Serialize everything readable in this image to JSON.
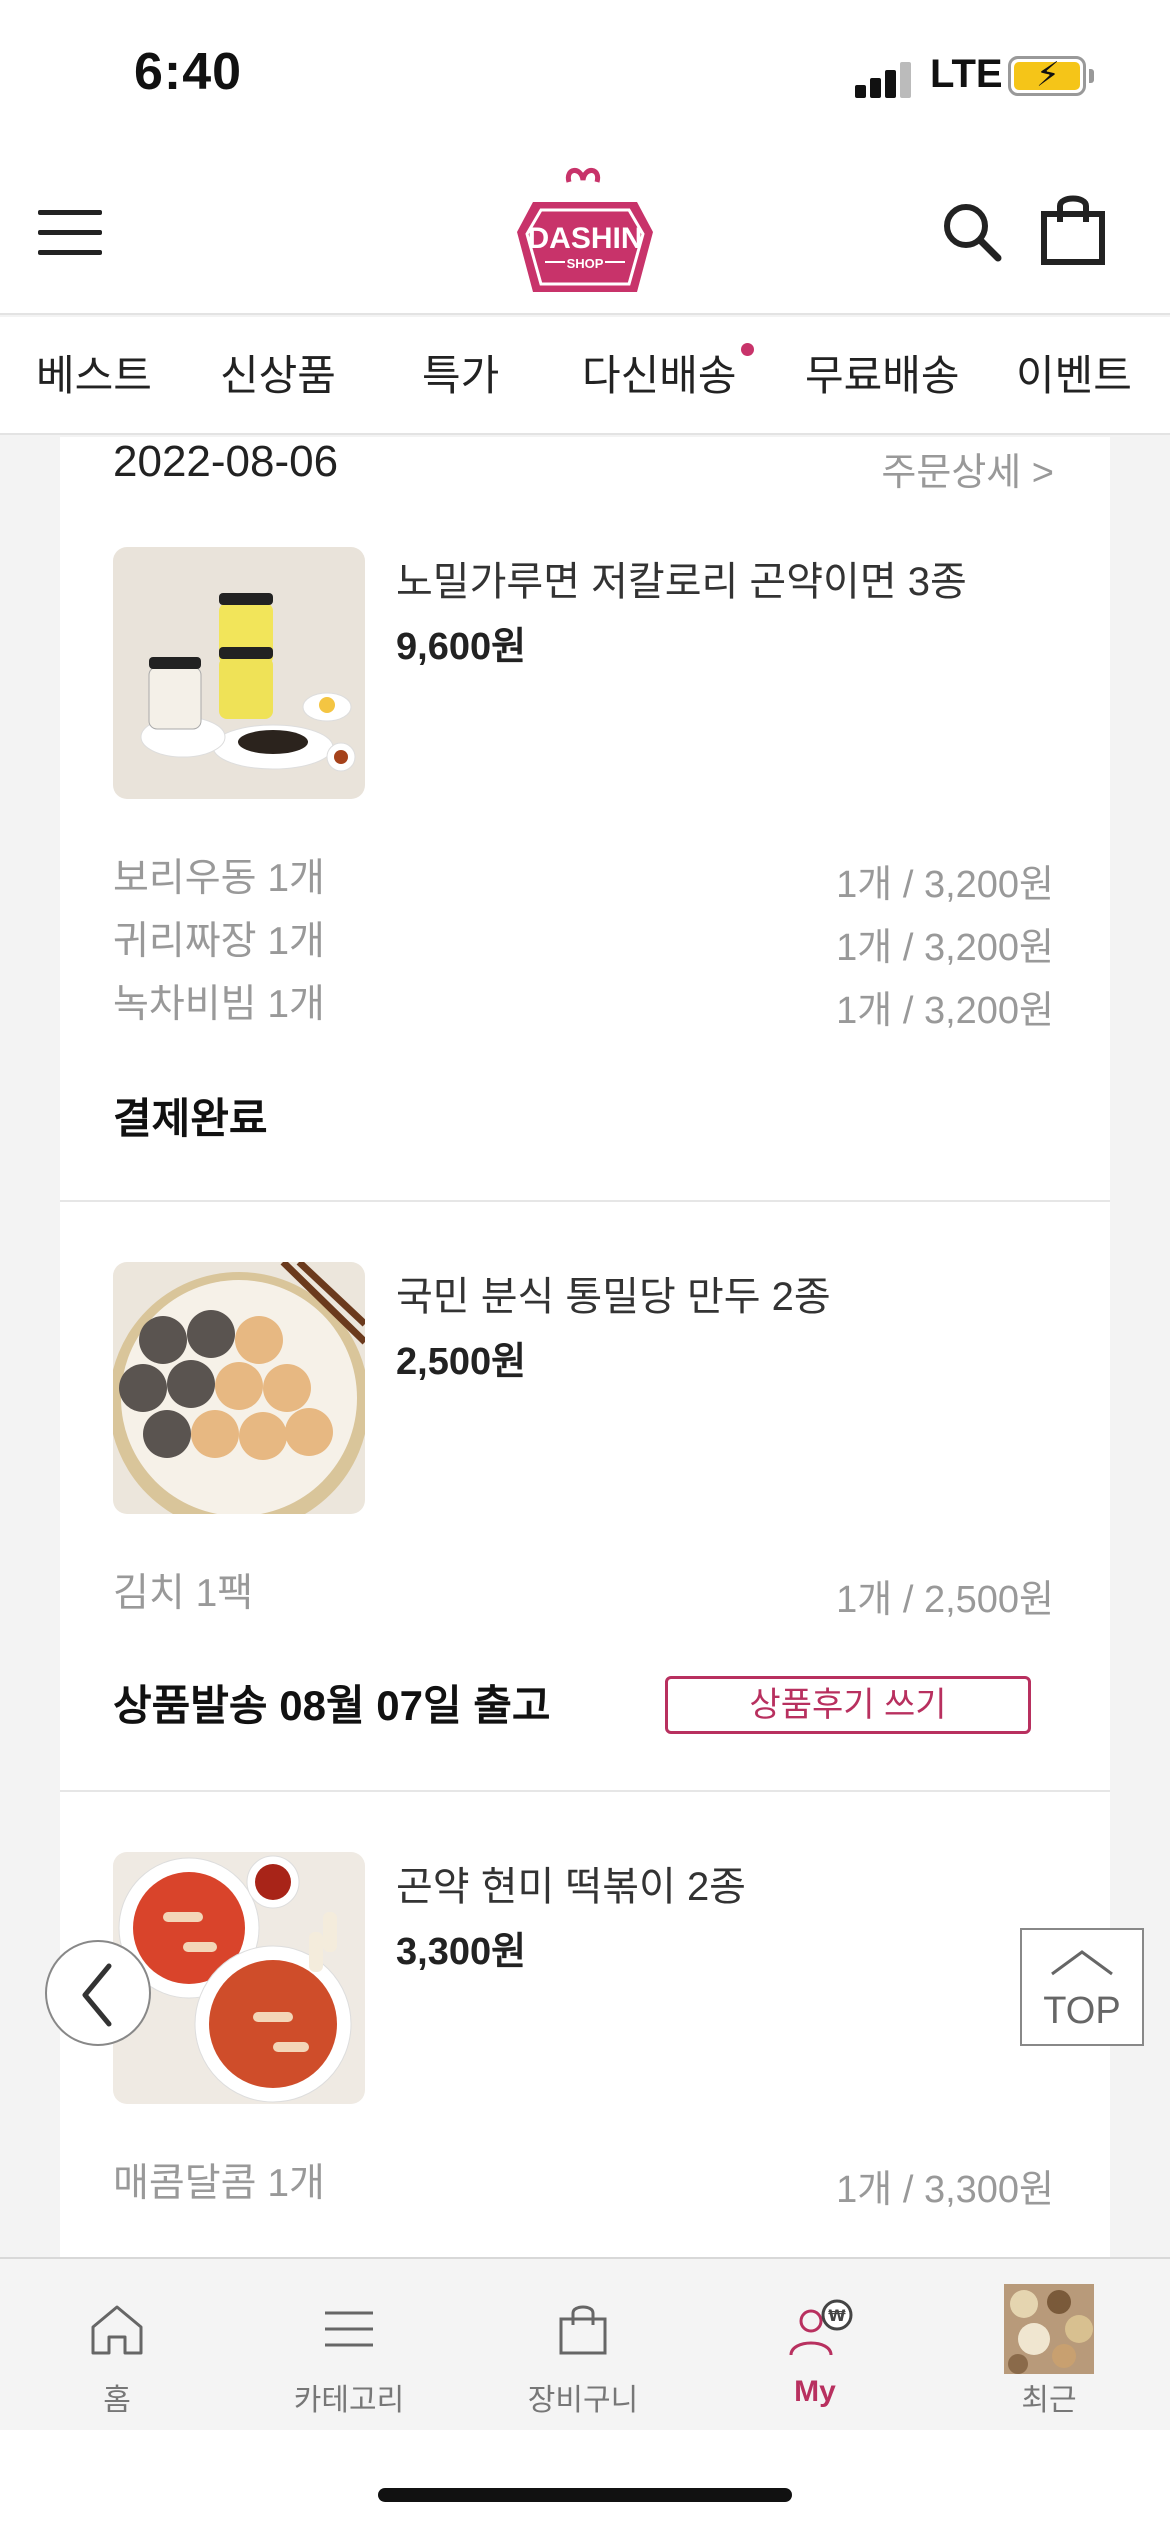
{
  "status_bar": {
    "time": "6:40",
    "network": "LTE"
  },
  "header": {
    "logo_text": "DASHIN",
    "logo_sub": "SHOP"
  },
  "nav": {
    "items": [
      {
        "label": "베스트",
        "dot": false
      },
      {
        "label": "신상품",
        "dot": false
      },
      {
        "label": "특가",
        "dot": false
      },
      {
        "label": "다신배송",
        "dot": true
      },
      {
        "label": "무료배송",
        "dot": false
      },
      {
        "label": "이벤트",
        "dot": false
      }
    ]
  },
  "order": {
    "date": "2022-08-06",
    "detail_link": "주문상세 >",
    "items": [
      {
        "name": "노밀가루면 저칼로리 곤약이면 3종",
        "price": "9,600원",
        "options": [
          {
            "name": "보리우동 1개",
            "qty": "1개 / 3,200원"
          },
          {
            "name": "귀리짜장 1개",
            "qty": "1개 / 3,200원"
          },
          {
            "name": "녹차비빔 1개",
            "qty": "1개 / 3,200원"
          }
        ],
        "status": "결제완료"
      },
      {
        "name": "국민 분식 통밀당 만두 2종",
        "price": "2,500원",
        "options": [
          {
            "name": "김치 1팩",
            "qty": "1개 / 2,500원"
          }
        ],
        "status": "상품발송  08월 07일 출고",
        "review_button": "상품후기 쓰기"
      },
      {
        "name": "곤약 현미 떡볶이 2종",
        "price": "3,300원",
        "options": [
          {
            "name": "매콤달콤 1개",
            "qty": "1개 / 3,300원"
          }
        ]
      }
    ]
  },
  "floating": {
    "top_label": "TOP"
  },
  "tabbar": {
    "items": [
      {
        "label": "홈",
        "icon": "home-icon",
        "active": false
      },
      {
        "label": "카테고리",
        "icon": "menu-icon",
        "active": false
      },
      {
        "label": "장비구니",
        "icon": "bag-icon",
        "active": false
      },
      {
        "label": "My",
        "icon": "user-won-icon",
        "active": true
      },
      {
        "label": "최근",
        "icon": "recent-product-thumbnail",
        "active": false
      }
    ]
  },
  "colors": {
    "accent": "#b8305f",
    "logo": "#c8336a",
    "battery": "#f5c518"
  }
}
